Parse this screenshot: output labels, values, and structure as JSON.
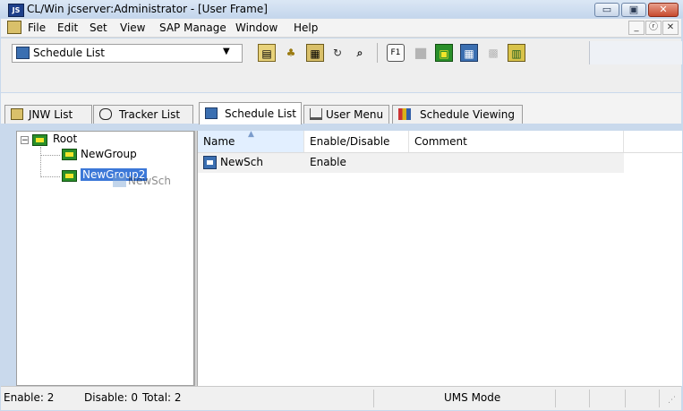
{
  "window": {
    "title": "CL/Win jcserver:Administrator - [User Frame]",
    "app_icon_text": "JS",
    "minimize_symbol": "▭",
    "maximize_symbol": "▣",
    "close_symbol": "✕"
  },
  "menubar": {
    "items": [
      "File",
      "Edit",
      "Set",
      "View",
      "SAP Manage",
      "Window",
      "Help"
    ],
    "mdi_minimize": "_",
    "mdi_restore": "ⓡ",
    "mdi_close": "✕"
  },
  "toolbar": {
    "combo_value": "Schedule List",
    "combo_arrow": "▼",
    "buttons": [
      {
        "icon": "properties-icon",
        "glyph": "▤"
      },
      {
        "icon": "tree-icon",
        "glyph": "♣"
      },
      {
        "icon": "schedule-icon",
        "glyph": "▦"
      },
      {
        "icon": "refresh-icon",
        "glyph": "↻"
      },
      {
        "icon": "binoculars-icon",
        "glyph": "⌕"
      },
      {
        "icon": "f1-help-icon",
        "glyph": "F1"
      },
      {
        "icon": "folder-icon",
        "glyph": "■"
      },
      {
        "icon": "network-icon",
        "glyph": "▣"
      },
      {
        "icon": "calendar-icon",
        "glyph": "▦"
      },
      {
        "icon": "grid-icon",
        "glyph": "▩"
      },
      {
        "icon": "log-icon",
        "glyph": "▥"
      }
    ]
  },
  "tabs": [
    {
      "label": "JNW List",
      "icon": "jnw-icon",
      "active": false
    },
    {
      "label": "Tracker List",
      "icon": "tracker-icon",
      "active": false
    },
    {
      "label": "Schedule List",
      "icon": "schedule-icon",
      "active": true
    },
    {
      "label": "User Menu",
      "icon": "user-menu-icon",
      "active": false
    },
    {
      "label": "Schedule Viewing",
      "icon": "schedule-viewing-icon",
      "active": false
    }
  ],
  "tree": {
    "root_label": "Root",
    "root_expander": "−",
    "children": [
      {
        "label": "NewGroup",
        "selected": false
      },
      {
        "label": "NewGroup2",
        "selected": true
      }
    ],
    "drag_ghost_label": "NewSch"
  },
  "list": {
    "columns": [
      "Name",
      "Enable/Disable",
      "Comment"
    ],
    "sorted_column": "Name",
    "sort_indicator": "▲",
    "rows": [
      {
        "name": "NewSch",
        "status": "Enable",
        "comment": ""
      }
    ]
  },
  "statusbar": {
    "enable": "Enable: 2",
    "disable": "Disable: 0",
    "total": "Total: 2",
    "mode": "UMS Mode",
    "grip": "⋰"
  },
  "colors": {
    "title_bar": "#c4d6ec",
    "selection": "#3c78d8",
    "folder_green": "#2a8f2a",
    "close_button": "#c74a2e"
  }
}
